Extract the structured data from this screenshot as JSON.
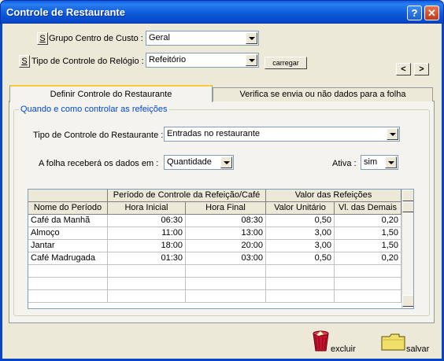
{
  "window": {
    "title": "Controle de Restaurante",
    "help_label": "?",
    "close_label": "✕"
  },
  "form": {
    "grupo": {
      "s_label": "S",
      "label": "Grupo Centro de Custo :",
      "value": "Geral"
    },
    "tipo_relogio": {
      "s_label": "S",
      "label": "Tipo de Controle do Relógio :",
      "value": "Refeitório"
    },
    "carregar_label": "carregar",
    "nav_prev": "<",
    "nav_next": ">"
  },
  "tabs": [
    {
      "label": "Definir Controle do Restaurante",
      "selected": true
    },
    {
      "label": "Verifica se envia ou não dados para a folha",
      "selected": false
    }
  ],
  "group": {
    "title": "Quando e como controlar as refeições",
    "tipo_restaurante": {
      "label": "Tipo de Controle do Restaurante :",
      "value": "Entradas no restaurante"
    },
    "folha": {
      "label": "A folha receberá os dados em :",
      "value": "Quantidade"
    },
    "ativa": {
      "label": "Ativa :",
      "value": "sim"
    }
  },
  "table": {
    "group_headers": [
      "Período de Controle da Refeição/Café",
      "Valor das Refeições"
    ],
    "columns": [
      "Nome do Período",
      "Hora Inicial",
      "Hora Final",
      "Valor Unitário",
      "Vl. das Demais"
    ],
    "rows": [
      [
        "Café da Manhã",
        "06:30",
        "08:30",
        "0,50",
        "0,20"
      ],
      [
        "Almoço",
        "11:00",
        "13:00",
        "3,00",
        "1,50"
      ],
      [
        "Jantar",
        "18:00",
        "20:00",
        "3,00",
        "1,50"
      ],
      [
        "Café Madrugada",
        "01:30",
        "03:00",
        "0,50",
        "0,20"
      ],
      [
        "",
        "",
        "",
        "",
        ""
      ],
      [
        "",
        "",
        "",
        "",
        ""
      ],
      [
        "",
        "",
        "",
        "",
        ""
      ]
    ]
  },
  "footer": {
    "excluir_label": "excluir",
    "salvar_label": "salvar"
  },
  "icons": {
    "excluir": "trash-bin-icon",
    "salvar": "folder-icon"
  },
  "colors": {
    "titlebar": "#0b58d9",
    "group_title": "#0046d5",
    "window_bg": "#ece9d8"
  }
}
